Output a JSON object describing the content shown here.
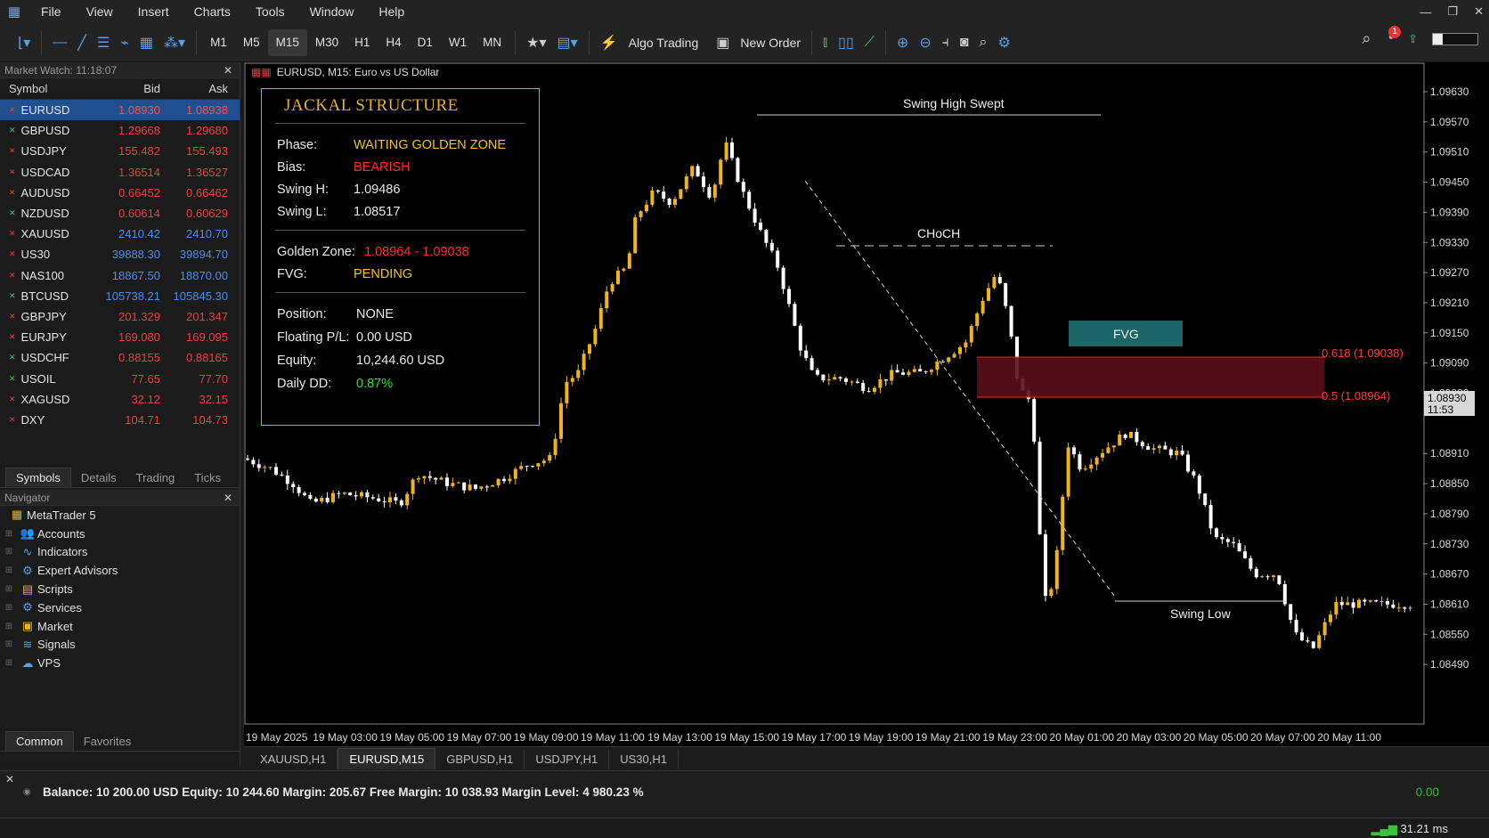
{
  "menu": [
    "File",
    "View",
    "Insert",
    "Charts",
    "Tools",
    "Window",
    "Help"
  ],
  "toolbar": {
    "timeframes": [
      "M1",
      "M5",
      "M15",
      "M30",
      "H1",
      "H4",
      "D1",
      "W1",
      "MN"
    ],
    "active_tf": "M15",
    "algo_trading": "Algo Trading",
    "new_order": "New Order",
    "notif_count": "1"
  },
  "market_watch": {
    "title": "Market Watch: 11:18:07",
    "headers": [
      "Symbol",
      "Bid",
      "Ask"
    ],
    "rows": [
      {
        "symbol": "EURUSD",
        "bid": "1.08930",
        "ask": "1.08938",
        "dir": "dn"
      },
      {
        "symbol": "GBPUSD",
        "bid": "1.29668",
        "ask": "1.29680",
        "dir": "dn"
      },
      {
        "symbol": "USDJPY",
        "bid": "155.482",
        "ask": "155.493",
        "dir": "dn"
      },
      {
        "symbol": "USDCAD",
        "bid": "1.36514",
        "ask": "1.36527",
        "dir": "dn"
      },
      {
        "symbol": "AUDUSD",
        "bid": "0.66452",
        "ask": "0.66462",
        "dir": "dn"
      },
      {
        "symbol": "NZDUSD",
        "bid": "0.60614",
        "ask": "0.60629",
        "dir": "dn"
      },
      {
        "symbol": "XAUUSD",
        "bid": "2410.42",
        "ask": "2410.70",
        "dir": "up"
      },
      {
        "symbol": "US30",
        "bid": "39888.30",
        "ask": "39894.70",
        "dir": "up"
      },
      {
        "symbol": "NAS100",
        "bid": "18867.50",
        "ask": "18870.00",
        "dir": "up"
      },
      {
        "symbol": "BTCUSD",
        "bid": "105738.21",
        "ask": "105845.30",
        "dir": "up"
      },
      {
        "symbol": "GBPJPY",
        "bid": "201.329",
        "ask": "201.347",
        "dir": "dn"
      },
      {
        "symbol": "EURJPY",
        "bid": "169.080",
        "ask": "169.095",
        "dir": "dn"
      },
      {
        "symbol": "USDCHF",
        "bid": "0.88155",
        "ask": "0.88165",
        "dir": "dn"
      },
      {
        "symbol": "USOIL",
        "bid": "77.65",
        "ask": "77.70",
        "dir": "dn"
      },
      {
        "symbol": "XAGUSD",
        "bid": "32.12",
        "ask": "32.15",
        "dir": "dn"
      },
      {
        "symbol": "DXY",
        "bid": "104.71",
        "ask": "104.73",
        "dir": "dn"
      }
    ],
    "tabs": [
      "Symbols",
      "Details",
      "Trading",
      "Ticks"
    ]
  },
  "navigator": {
    "title": "Navigator",
    "root": "MetaTrader 5",
    "items": [
      "Accounts",
      "Indicators",
      "Expert Advisors",
      "Scripts",
      "Services",
      "Market",
      "Signals",
      "VPS"
    ],
    "tabs": [
      "Common",
      "Favorites"
    ]
  },
  "chart": {
    "title": "EURUSD, M15: Euro vs US Dollar",
    "price_labels": [
      "1.09630",
      "1.09570",
      "1.09510",
      "1.09450",
      "1.09390",
      "1.09330",
      "1.09270",
      "1.09210",
      "1.09150",
      "1.09090",
      "1.09030",
      "1.08910",
      "1.08850",
      "1.08790",
      "1.08730",
      "1.08670",
      "1.08610",
      "1.08550",
      "1.08490"
    ],
    "current_price": "1.08930",
    "current_time": "11:53",
    "time_labels": [
      "19 May 2025",
      "19 May 03:00",
      "19 May 05:00",
      "19 May 07:00",
      "19 May 09:00",
      "19 May 11:00",
      "19 May 13:00",
      "19 May 15:00",
      "19 May 17:00",
      "19 May 19:00",
      "19 May 21:00",
      "19 May 23:00",
      "20 May 01:00",
      "20 May 03:00",
      "20 May 05:00",
      "20 May 07:00",
      "20 May 11:00"
    ],
    "annotations": {
      "swing_high": "Swing High Swept",
      "choch": "CHoCH",
      "fvg": "FVG",
      "fib618": "0.618 (1.09038)",
      "fib50": "0.5 (1.08964)",
      "swing_low": "Swing Low"
    },
    "colors": {
      "bull": "#f0b41a",
      "bear": "#ffffff",
      "fvg": "#1d6b6e",
      "zone": "#5a0f18",
      "zone_line": "#e02a2a"
    }
  },
  "jackal": {
    "title": "JACKAL STRUCTURE",
    "phase_k": "Phase:",
    "phase_v": "WAITING GOLDEN ZONE",
    "bias_k": "Bias:",
    "bias_v": "BEARISH",
    "sh_k": "Swing H:",
    "sh_v": "1.09486",
    "sl_k": "Swing L:",
    "sl_v": "1.08517",
    "gz_k": "Golden Zone:",
    "gz_v": "1.08964 - 1.09038",
    "fvg_k": "FVG:",
    "fvg_v": "PENDING",
    "pos_k": "Position:",
    "pos_v": "NONE",
    "fpl_k": "Floating P/L:",
    "fpl_v": "0.00 USD",
    "eq_k": "Equity:",
    "eq_v": "10,244.60 USD",
    "dd_k": "Daily DD:",
    "dd_v": "0.87%"
  },
  "chart_tabs": [
    "XAUUSD,H1",
    "EURUSD,M15",
    "GBPUSD,H1",
    "USDJPY,H1",
    "US30,H1"
  ],
  "active_chart_tab": "EURUSD,M15",
  "account": {
    "summary": "Balance: 10 200.00 USD  Equity: 10 244.60  Margin: 205.67  Free Margin: 10 038.93  Margin Level: 4 980.23 %",
    "pl": "0.00"
  },
  "status": {
    "ping": "31.21 ms"
  }
}
